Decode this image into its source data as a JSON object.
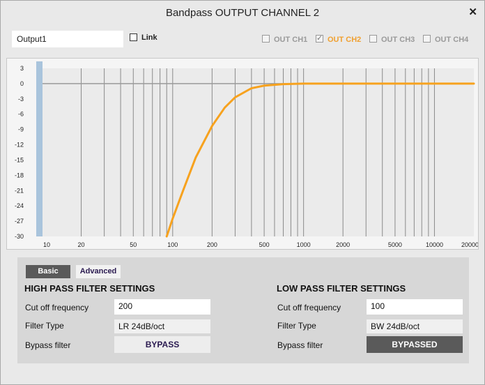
{
  "window": {
    "title": "Bandpass OUTPUT CHANNEL 2"
  },
  "output_name": {
    "value": "Output1"
  },
  "link": {
    "label": "Link",
    "checked": false
  },
  "channels": [
    {
      "label": "OUT CH1",
      "checked": false,
      "active": false
    },
    {
      "label": "OUT CH2",
      "checked": true,
      "active": true
    },
    {
      "label": "OUT CH3",
      "checked": false,
      "active": false
    },
    {
      "label": "OUT CH4",
      "checked": false,
      "active": false
    }
  ],
  "graph": {
    "y_ticks": [
      "3",
      "0",
      "-3",
      "-6",
      "-9",
      "-12",
      "-15",
      "-18",
      "-21",
      "-24",
      "-27",
      "-30"
    ],
    "x_ticks": [
      "10",
      "20",
      "50",
      "100",
      "200",
      "500",
      "1000",
      "2000",
      "5000",
      "10000",
      "20000"
    ],
    "curve_color": "#f7a21e"
  },
  "chart_data": {
    "type": "line",
    "xscale": "log",
    "xlim": [
      10,
      20000
    ],
    "ylim": [
      -30,
      3
    ],
    "x_ticks": [
      10,
      20,
      50,
      100,
      200,
      500,
      1000,
      2000,
      5000,
      10000,
      20000
    ],
    "y_ticks": [
      3,
      0,
      -3,
      -6,
      -9,
      -12,
      -15,
      -18,
      -21,
      -24,
      -27,
      -30
    ],
    "series": [
      {
        "x": [
          90,
          100,
          120,
          150,
          200,
          250,
          300,
          400,
          500,
          700,
          1000,
          2000,
          5000,
          10000,
          20000
        ],
        "y": [
          -30,
          -26.5,
          -21,
          -14.5,
          -8.3,
          -4.7,
          -2.7,
          -0.9,
          -0.4,
          -0.1,
          0,
          0,
          0,
          0,
          0
        ]
      }
    ]
  },
  "tabs": {
    "basic": "Basic",
    "advanced": "Advanced"
  },
  "high_pass": {
    "title": "HIGH PASS FILTER SETTINGS",
    "cutoff_label": "Cut off frequency",
    "cutoff_value": "200",
    "type_label": "Filter Type",
    "type_value": "LR 24dB/oct",
    "bypass_label": "Bypass filter",
    "bypass_button": "BYPASS"
  },
  "low_pass": {
    "title": "LOW PASS FILTER SETTINGS",
    "cutoff_label": "Cut off frequency",
    "cutoff_value": "100",
    "type_label": "Filter Type",
    "type_value": "BW 24dB/oct",
    "bypass_label": "Bypass filter",
    "bypass_button": "BYPASSED"
  }
}
